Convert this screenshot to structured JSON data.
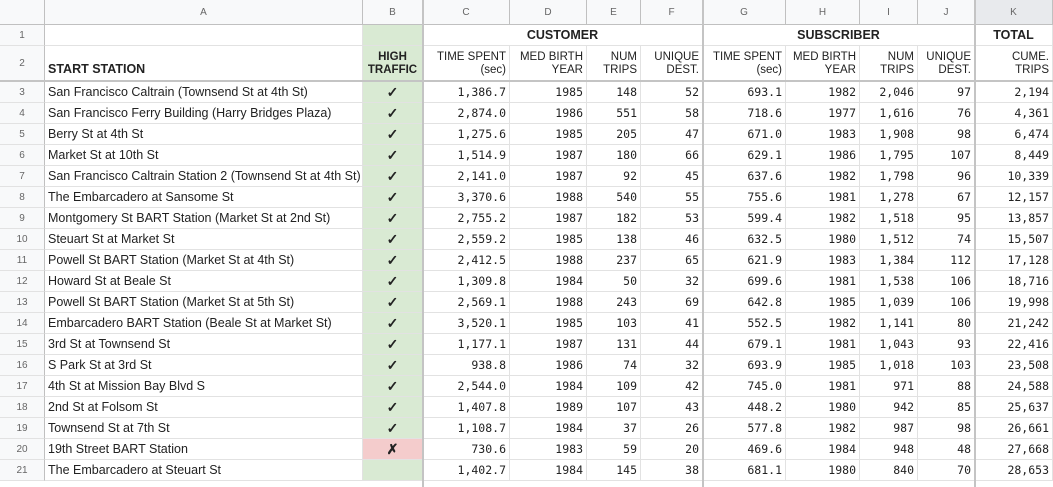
{
  "columns": [
    "A",
    "B",
    "C",
    "D",
    "E",
    "F",
    "G",
    "H",
    "I",
    "J",
    "K"
  ],
  "row_numbers": [
    "1",
    "2",
    "3",
    "4",
    "5",
    "6",
    "7",
    "8",
    "9",
    "10",
    "11",
    "12",
    "13",
    "14",
    "15",
    "16",
    "17",
    "18",
    "19",
    "20",
    "21"
  ],
  "groups": {
    "customer": "CUSTOMER",
    "subscriber": "SUBSCRIBER",
    "total": "TOTAL"
  },
  "headers": {
    "start_station": "START STATION",
    "high_traffic": [
      "HIGH",
      "TRAFFIC"
    ],
    "c_time": [
      "TIME SPENT",
      "(sec)"
    ],
    "c_birth": [
      "MED BIRTH",
      "YEAR"
    ],
    "c_trips": [
      "NUM",
      "TRIPS"
    ],
    "c_dest": [
      "UNIQUE",
      "DEST."
    ],
    "s_time": [
      "TIME SPENT",
      "(sec)"
    ],
    "s_birth": [
      "MED BIRTH",
      "YEAR"
    ],
    "s_trips": [
      "NUM",
      "TRIPS"
    ],
    "s_dest": [
      "UNIQUE",
      "DEST."
    ],
    "cume": [
      "CUME.",
      "TRIPS"
    ]
  },
  "rows": [
    [
      "San Francisco Caltrain (Townsend St at 4th St)",
      "✓",
      "1,386.7",
      "1985",
      "148",
      "52",
      "693.1",
      "1982",
      "2,046",
      "97",
      "2,194"
    ],
    [
      "San Francisco Ferry Building (Harry Bridges Plaza)",
      "✓",
      "2,874.0",
      "1986",
      "551",
      "58",
      "718.6",
      "1977",
      "1,616",
      "76",
      "4,361"
    ],
    [
      "Berry St at 4th St",
      "✓",
      "1,275.6",
      "1985",
      "205",
      "47",
      "671.0",
      "1983",
      "1,908",
      "98",
      "6,474"
    ],
    [
      "Market St at 10th St",
      "✓",
      "1,514.9",
      "1987",
      "180",
      "66",
      "629.1",
      "1986",
      "1,795",
      "107",
      "8,449"
    ],
    [
      "San Francisco Caltrain Station 2  (Townsend St at 4th St)",
      "✓",
      "2,141.0",
      "1987",
      "92",
      "45",
      "637.6",
      "1982",
      "1,798",
      "96",
      "10,339"
    ],
    [
      "The Embarcadero at Sansome St",
      "✓",
      "3,370.6",
      "1988",
      "540",
      "55",
      "755.6",
      "1981",
      "1,278",
      "67",
      "12,157"
    ],
    [
      "Montgomery St BART Station (Market St at 2nd St)",
      "✓",
      "2,755.2",
      "1987",
      "182",
      "53",
      "599.4",
      "1982",
      "1,518",
      "95",
      "13,857"
    ],
    [
      "Steuart St at Market St",
      "✓",
      "2,559.2",
      "1985",
      "138",
      "46",
      "632.5",
      "1980",
      "1,512",
      "74",
      "15,507"
    ],
    [
      "Powell St BART Station (Market St at 4th St)",
      "✓",
      "2,412.5",
      "1988",
      "237",
      "65",
      "621.9",
      "1983",
      "1,384",
      "112",
      "17,128"
    ],
    [
      "Howard St at Beale St",
      "✓",
      "1,309.8",
      "1984",
      "50",
      "32",
      "699.6",
      "1981",
      "1,538",
      "106",
      "18,716"
    ],
    [
      "Powell St BART Station (Market St at 5th St)",
      "✓",
      "2,569.1",
      "1988",
      "243",
      "69",
      "642.8",
      "1985",
      "1,039",
      "106",
      "19,998"
    ],
    [
      "Embarcadero BART Station (Beale St at Market St)",
      "✓",
      "3,520.1",
      "1985",
      "103",
      "41",
      "552.5",
      "1982",
      "1,141",
      "80",
      "21,242"
    ],
    [
      "3rd St at Townsend St",
      "✓",
      "1,177.1",
      "1987",
      "131",
      "44",
      "679.1",
      "1981",
      "1,043",
      "93",
      "22,416"
    ],
    [
      "S Park St at 3rd St",
      "✓",
      "938.8",
      "1986",
      "74",
      "32",
      "693.9",
      "1985",
      "1,018",
      "103",
      "23,508"
    ],
    [
      "4th St at Mission Bay Blvd S",
      "✓",
      "2,544.0",
      "1984",
      "109",
      "42",
      "745.0",
      "1981",
      "971",
      "88",
      "24,588"
    ],
    [
      "2nd St at Folsom St",
      "✓",
      "1,407.8",
      "1989",
      "107",
      "43",
      "448.2",
      "1980",
      "942",
      "85",
      "25,637"
    ],
    [
      "Townsend St at 7th St",
      "✓",
      "1,108.7",
      "1984",
      "37",
      "26",
      "577.8",
      "1982",
      "987",
      "98",
      "26,661"
    ],
    [
      "19th Street BART Station",
      "✗",
      "730.6",
      "1983",
      "59",
      "20",
      "469.6",
      "1984",
      "948",
      "48",
      "27,668"
    ],
    [
      "The Embarcadero at Steuart St",
      "✓",
      "1,402.7",
      "1984",
      "145",
      "38",
      "681.1",
      "1980",
      "840",
      "70",
      "28,653"
    ]
  ],
  "colors": {
    "high": "#d9ead3",
    "low": "#f4cccc"
  }
}
